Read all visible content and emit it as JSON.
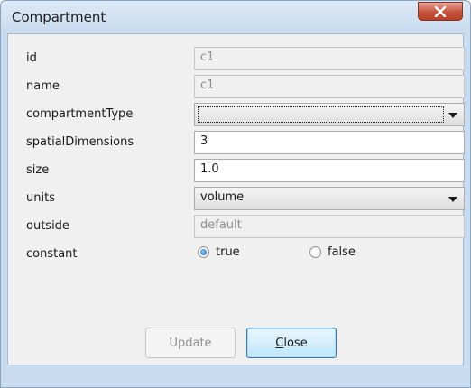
{
  "window": {
    "title": "Compartment"
  },
  "fields": {
    "id": {
      "label": "id",
      "value": "c1"
    },
    "name": {
      "label": "name",
      "value": "c1"
    },
    "compartmentType": {
      "label": "compartmentType",
      "value": ""
    },
    "spatialDimensions": {
      "label": "spatialDimensions",
      "value": "3"
    },
    "size": {
      "label": "size",
      "value": "1.0"
    },
    "units": {
      "label": "units",
      "value": "volume"
    },
    "outside": {
      "label": "outside",
      "value": "default"
    },
    "constant": {
      "label": "constant",
      "options": [
        {
          "label": "true",
          "checked": true
        },
        {
          "label": "false",
          "checked": false
        }
      ]
    }
  },
  "buttons": {
    "update": "Update",
    "close_mnemonic": "C",
    "close_rest": "lose"
  }
}
